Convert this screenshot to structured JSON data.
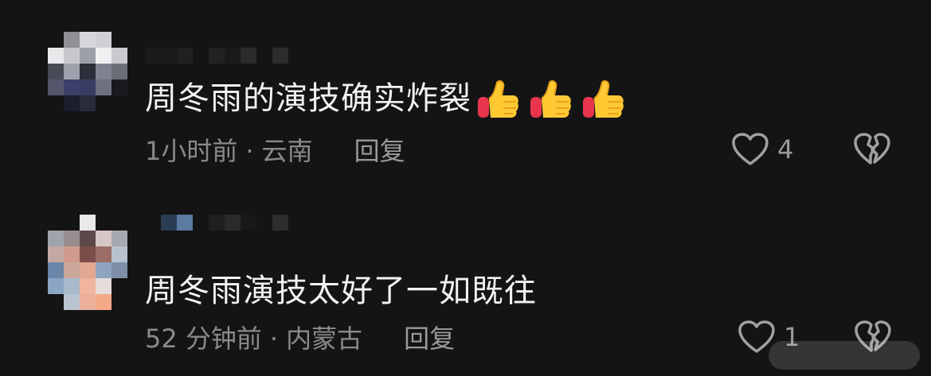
{
  "comments": [
    {
      "text": "周冬雨的演技确实炸裂",
      "emoji": [
        "thumbs-up",
        "thumbs-up",
        "thumbs-up"
      ],
      "time": "1小时前",
      "location": "云南",
      "reply_label": "回复",
      "likes": "4",
      "username": "",
      "avatar_colors": [
        [
          "#141414",
          "#8f9096",
          "#d6d6db",
          "#cfd0d4",
          "#141414"
        ],
        [
          "#e9e9ec",
          "#c8c8cc",
          "#9ea0a8",
          "#f0f0f2",
          "#c9c9ce"
        ],
        [
          "#474a54",
          "#9fa2ad",
          "#2c2f3a",
          "#7e8190",
          "#6b6e78"
        ],
        [
          "#54576b",
          "#3c3f6a",
          "#3a3d63",
          "#6f7080",
          "#191a1e"
        ],
        [
          "#141414",
          "#1c1d2c",
          "#2a2b3a",
          "#141414",
          "#141414"
        ]
      ]
    },
    {
      "text": "周冬雨演技太好了一如既往",
      "emoji": [],
      "time": "52 分钟前",
      "location": "内蒙古",
      "reply_label": "回复",
      "likes": "1",
      "username": "",
      "avatar_colors": [
        [
          "#141414",
          "#141414",
          "#e8e8ea",
          "#141414",
          "#141414"
        ],
        [
          "#9fa3ab",
          "#9a8d8f",
          "#5c4a4a",
          "#d7c6c6",
          "#a7a9b0"
        ],
        [
          "#c3a8a3",
          "#d09a8c",
          "#7b4e4b",
          "#9a6d66",
          "#b8c2cf"
        ],
        [
          "#6a86a8",
          "#caa69b",
          "#e2a892",
          "#8fa5bf",
          "#7d8fa6"
        ],
        [
          "#8aa6c4",
          "#a7b9cb",
          "#f0b59d",
          "#e6dcd9",
          "#141414"
        ],
        [
          "#141414",
          "#b9c4d0",
          "#eab09a",
          "#f5a888",
          "#141414"
        ]
      ]
    }
  ],
  "separator": "·",
  "colors": {
    "background": "#141414",
    "text": "#f2f2f2",
    "meta": "#8a8a8a"
  },
  "icons": {
    "like": "heart-outline-icon",
    "dislike": "broken-heart-icon"
  }
}
